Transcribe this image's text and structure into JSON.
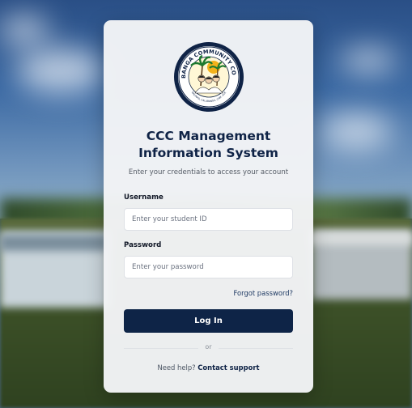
{
  "logo": {
    "text_top": "CALABANGA COMMUNITY COLLEGE",
    "text_bottom": "BALINAD, CALABANGA, CAM. SUR"
  },
  "header": {
    "title_line1": "CCC Management",
    "title_line2": "Information System",
    "subtitle": "Enter your credentials to access your account"
  },
  "form": {
    "username_label": "Username",
    "username_placeholder": "Enter your student ID",
    "username_value": "",
    "password_label": "Password",
    "password_placeholder": "Enter your password",
    "password_value": "",
    "forgot_label": "Forgot password?",
    "login_label": "Log In",
    "divider_text": "or"
  },
  "footer": {
    "help_text": "Need help?",
    "support_link": "Contact support"
  },
  "colors": {
    "primary": "#0e2447",
    "card_bg": "#f3f4f6"
  }
}
